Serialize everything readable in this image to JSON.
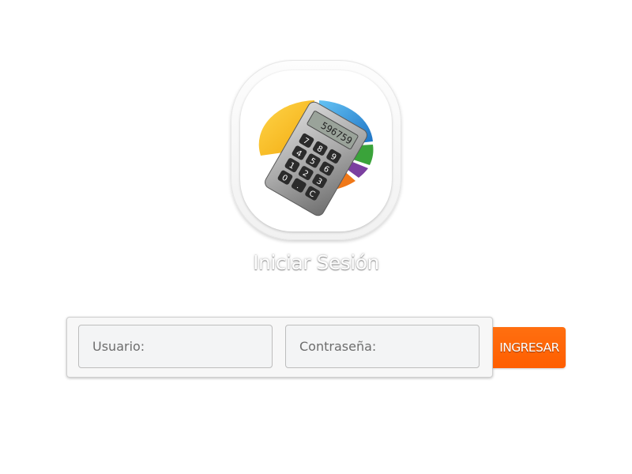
{
  "app": {
    "logo_icon": "calculator-pie-chart-icon"
  },
  "login": {
    "title": "Iniciar Sesión",
    "username": {
      "placeholder": "Usuario:",
      "value": ""
    },
    "password": {
      "placeholder": "Contraseña:",
      "value": ""
    },
    "submit_label": "INGRESAR"
  },
  "calculator_display": "596759",
  "calculator_keys": [
    "7",
    "8",
    "9",
    "4",
    "5",
    "6",
    "1",
    "2",
    "3",
    "0",
    ".",
    "C"
  ],
  "colors": {
    "accent": "#ff6600",
    "background": "#ffffff",
    "field_bg": "#f3f4f5",
    "pie_yellow": "#f5b820",
    "pie_blue": "#2a8fd8",
    "pie_green": "#3aa33a",
    "pie_purple": "#7b3fa0",
    "pie_orange": "#f07818"
  }
}
